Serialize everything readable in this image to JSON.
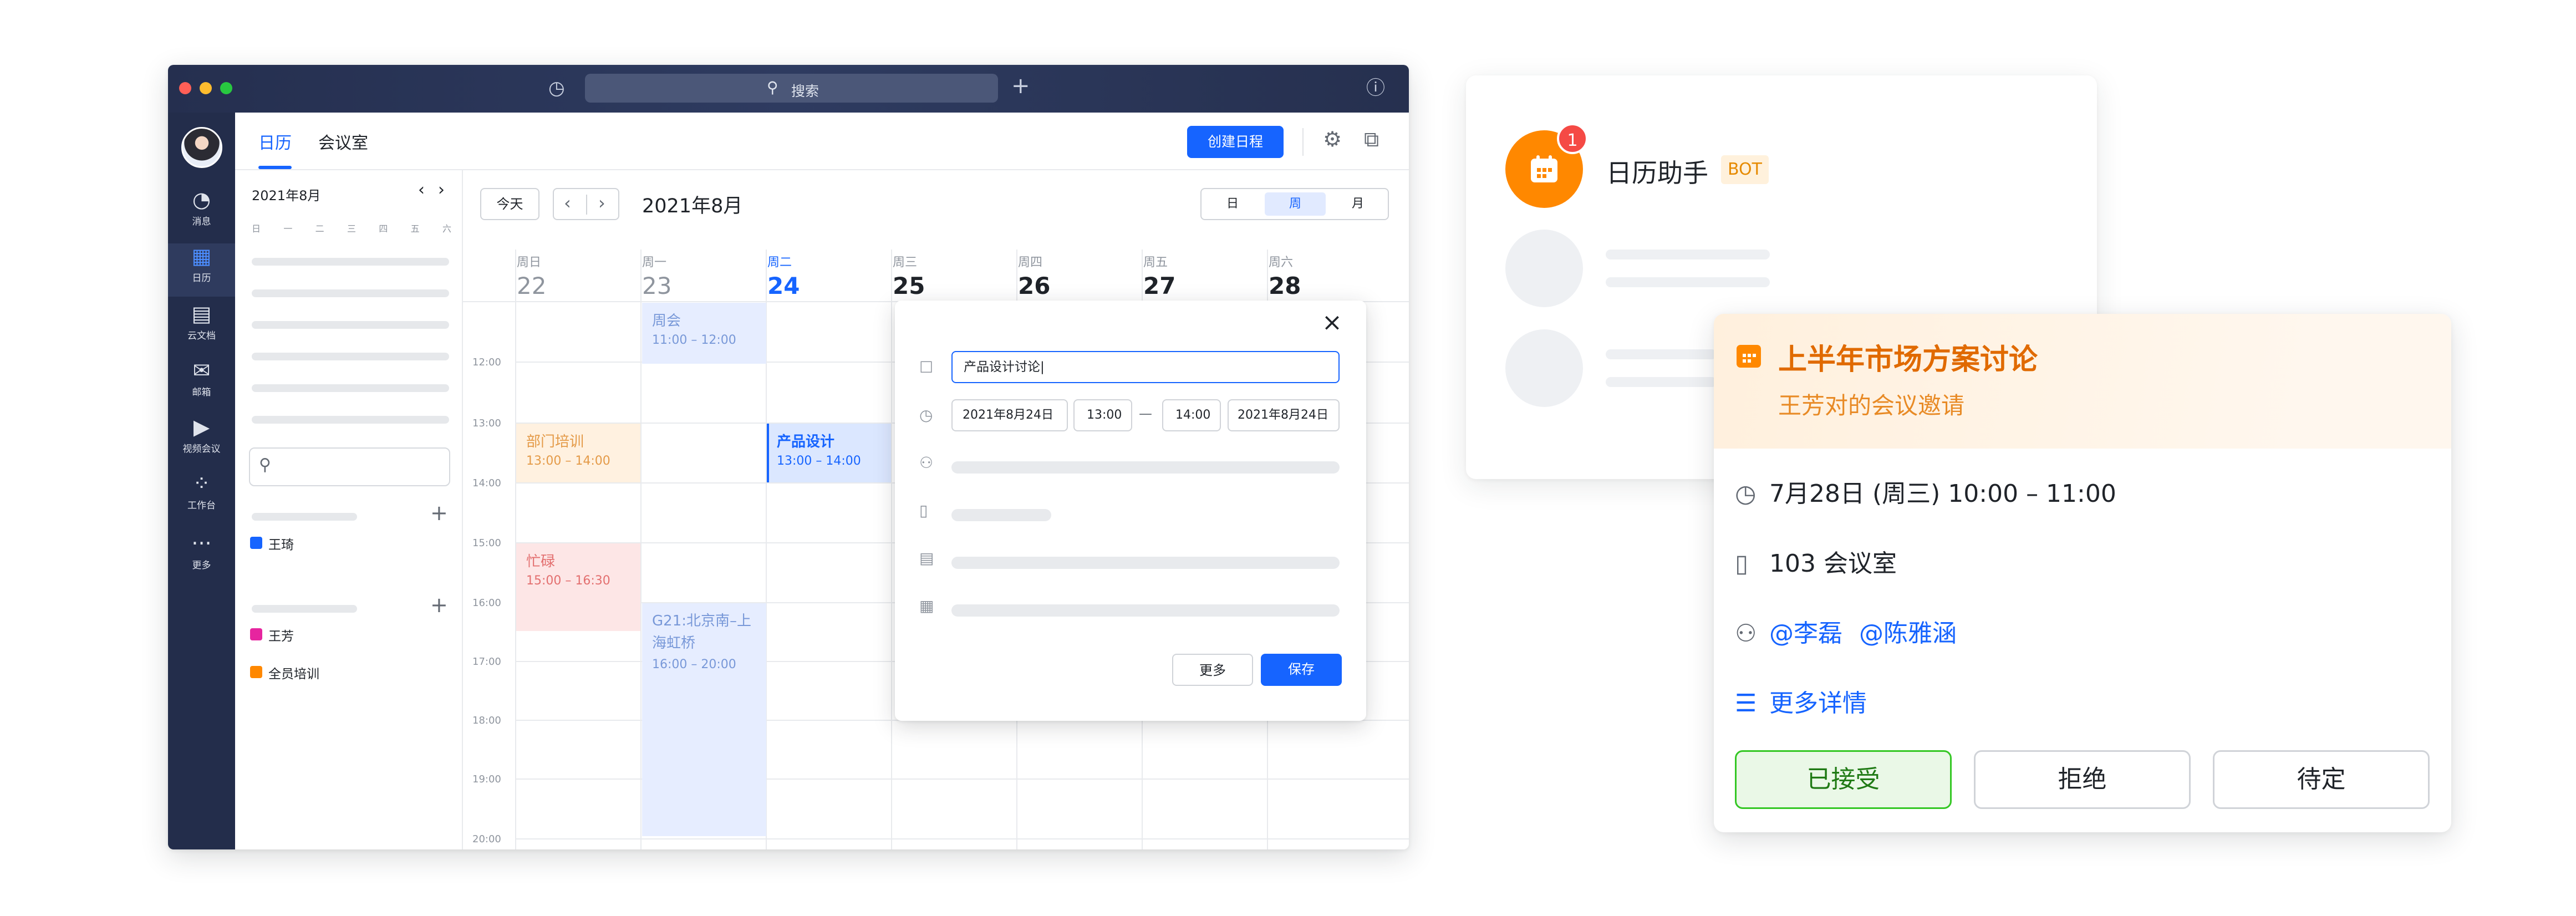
{
  "titlebar": {
    "search_placeholder": "搜索"
  },
  "nav": {
    "items": [
      "消息",
      "日历",
      "云文档",
      "邮箱",
      "视频会议",
      "工作台",
      "更多"
    ]
  },
  "header": {
    "tabs": [
      "日历",
      "会议室"
    ],
    "create_label": "创建日程"
  },
  "sidebar": {
    "month": "2021年8月",
    "weekdays": [
      "日",
      "一",
      "二",
      "三",
      "四",
      "五",
      "六"
    ],
    "group1_items": [
      {
        "label": "王琦",
        "color": "#1664ff"
      }
    ],
    "group2_items": [
      {
        "label": "王芳",
        "color": "#e6259f"
      },
      {
        "label": "全员培训",
        "color": "#ff8800"
      }
    ]
  },
  "calendar": {
    "today_label": "今天",
    "month_title": "2021年8月",
    "views": [
      "日",
      "周",
      "月"
    ],
    "days": [
      {
        "weekday": "周日",
        "date": "22"
      },
      {
        "weekday": "周一",
        "date": "23"
      },
      {
        "weekday": "周二",
        "date": "24"
      },
      {
        "weekday": "周三",
        "date": "25"
      },
      {
        "weekday": "周四",
        "date": "26"
      },
      {
        "weekday": "周五",
        "date": "27"
      },
      {
        "weekday": "周六",
        "date": "28"
      }
    ],
    "times": [
      "12:00",
      "13:00",
      "14:00",
      "15:00",
      "16:00",
      "17:00",
      "18:00",
      "19:00",
      "20:00"
    ],
    "events": [
      {
        "title": "周会",
        "time": "11:00 – 12:00"
      },
      {
        "title": "部门培训",
        "time": "13:00 – 14:00"
      },
      {
        "title": "产品设计",
        "time": "13:00 – 14:00"
      },
      {
        "title": "忙碌",
        "time": "15:00 – 16:30"
      },
      {
        "title": "G21:北京南–上海虹桥",
        "time": "16:00 – 20:00"
      }
    ]
  },
  "popup": {
    "title_value": "产品设计讨论",
    "start_date": "2021年8月24日",
    "start_time": "13:00",
    "dash": "—",
    "end_time": "14:00",
    "end_date": "2021年8月24日",
    "more_label": "更多",
    "save_label": "保存"
  },
  "bot": {
    "name": "日历助手",
    "tag": "BOT",
    "badge_count": "1"
  },
  "invite": {
    "title": "上半年市场方案讨论",
    "subtitle": "王芳对的会议邀请",
    "time": "7月28日 (周三) 10:00 – 11:00",
    "room": "103 会议室",
    "attendees": [
      "@李磊",
      "@陈雅涵"
    ],
    "more_details": "更多详情",
    "accept_label": "已接受",
    "decline_label": "拒绝",
    "tentative_label": "待定"
  }
}
